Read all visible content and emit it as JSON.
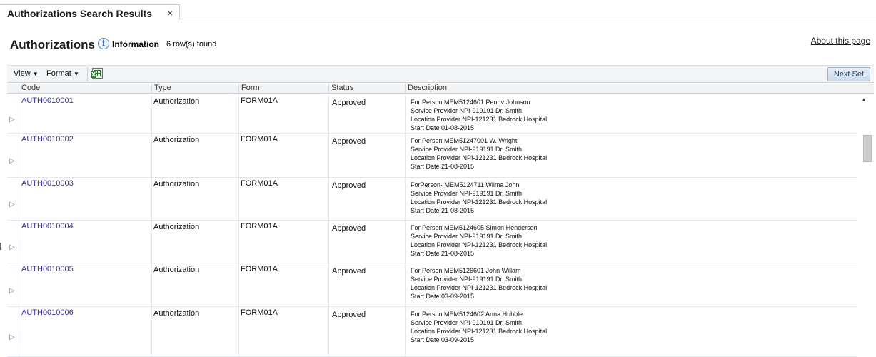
{
  "tab": {
    "title": "Authorizations Search Results",
    "close": "×"
  },
  "header": {
    "title": "Authorizations",
    "info_label": "Information",
    "info_count": "6 row(s) found",
    "about_link": "About this page"
  },
  "toolbar": {
    "view_label": "View",
    "format_label": "Format",
    "next_set_label": "Next Set"
  },
  "columns": [
    "Code",
    "Type",
    "Form",
    "Status",
    "Description"
  ],
  "rows": [
    {
      "code": "AUTH0010001",
      "type": "Authorization",
      "form": "FORM01A",
      "status": "Approved",
      "description": [
        "For Person  MEM5124601 Pennv Johnson",
        "Service Provider NPI-919191 Dr. Smith",
        "Location Provider NPI-121231 Bedrock Hospital",
        "Start Date 01-08-2015"
      ]
    },
    {
      "code": "AUTH0010002",
      "type": "Authorization",
      "form": "FORM01A",
      "status": "Approved",
      "description": [
        "For Person  MEM51247001 W. Wright",
        "Service Provider NPI-919191 Dr. Smith",
        "Location Provider NPI-121231 Bedrock Hospital",
        "Start Date  21-08-2015"
      ]
    },
    {
      "code": "AUTH0010003",
      "type": "Authorization",
      "form": "FORM01A",
      "status": "Approved",
      "description": [
        "ForPerson·  MEM5124711 Wilma John",
        "Service Provider NPI-919191 Dr. Smith",
        "Location Provider NPI-121231 Bedrock Hospital",
        "Start Date 21-08-2015"
      ]
    },
    {
      "code": "AUTH0010004",
      "type": "Authorization",
      "form": "FORM01A",
      "status": "Approved",
      "description": [
        "For Person  MEM5124605 Simon Henderson",
        "Service Provider NPI-919191 Dr. Smith",
        "Location Provider NPI-121231 Bedrock Hospital",
        "Start Date 21-08-2015"
      ]
    },
    {
      "code": "AUTH0010005",
      "type": "Authorization",
      "form": "FORM01A",
      "status": "Approved",
      "description": [
        "For Person  MEM5126601 John Willam",
        "Service Provider NPI-919191 Dr. Smith",
        "Location Provider NPI-121231 Bedrock Hospital",
        "Start Date  03-09-2015"
      ]
    },
    {
      "code": "AUTH0010006",
      "type": "Authorization",
      "form": "FORM01A",
      "status": "Approved",
      "description": [
        "For Person  MEM5124602 Anna Hubble",
        "Service Provider NPI-919191 Dr. Smith",
        "Location Provider NPI-121231 Bedrock Hospital",
        "Start Date 03-09-2015"
      ]
    }
  ]
}
